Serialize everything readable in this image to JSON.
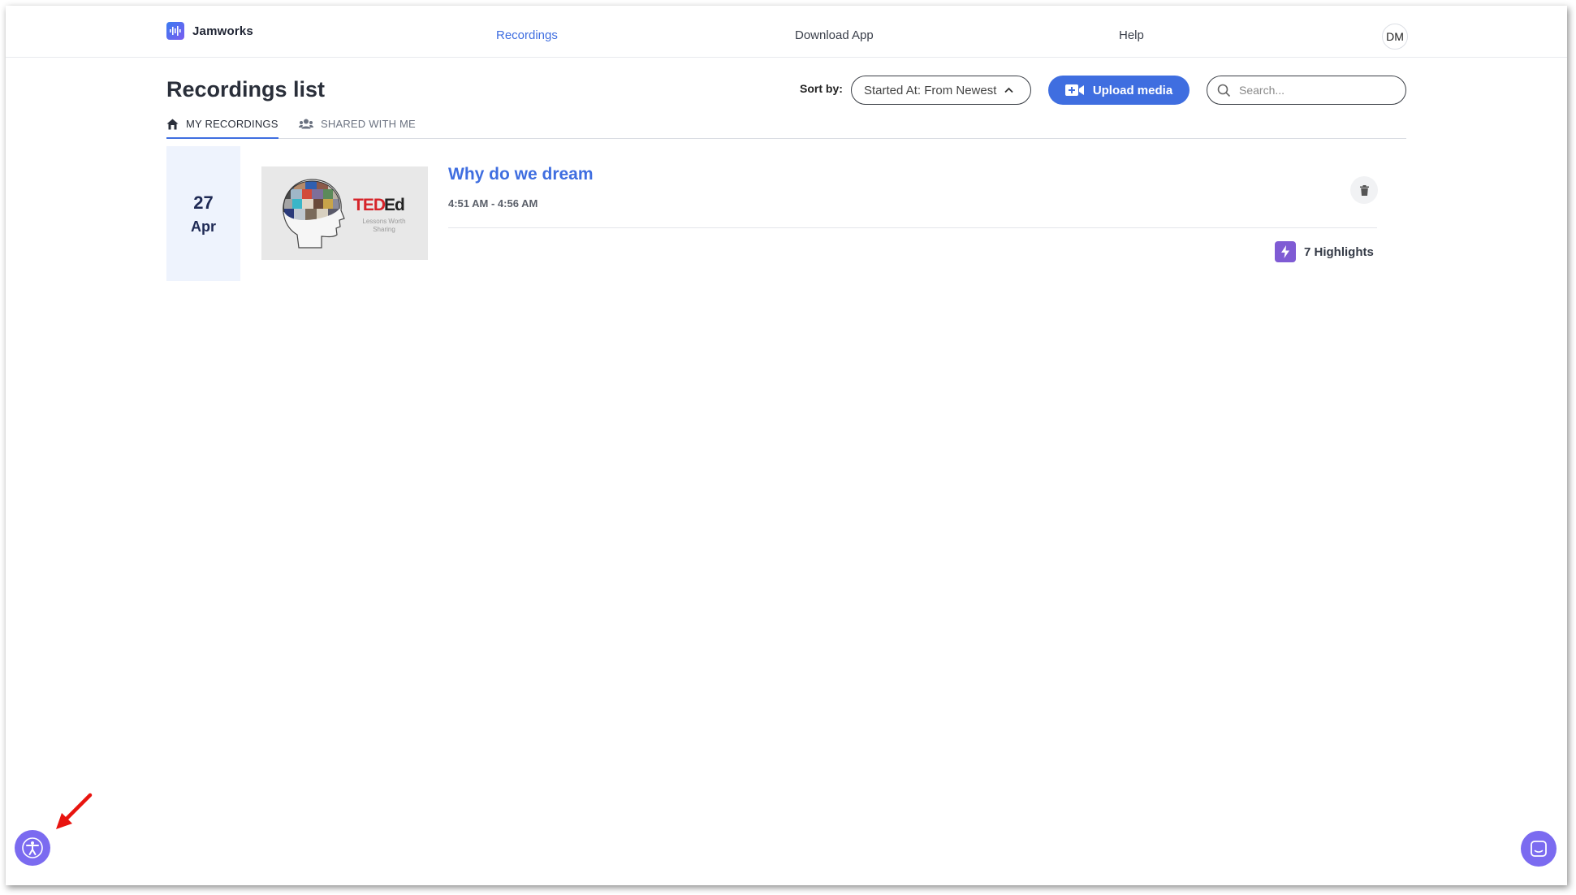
{
  "app": {
    "name": "Jamworks"
  },
  "nav": {
    "links": [
      "Recordings",
      "Download App",
      "Help"
    ],
    "active": "Recordings",
    "avatar_initials": "DM"
  },
  "header": {
    "title": "Recordings list",
    "sort_label": "Sort by:",
    "sort_value": "Started At: From Newest",
    "upload_label": "Upload media",
    "search_placeholder": "Search..."
  },
  "tabs": [
    {
      "label": "MY RECORDINGS",
      "icon": "home-icon",
      "active": true
    },
    {
      "label": "SHARED WITH ME",
      "icon": "users-icon",
      "active": false
    }
  ],
  "recordings": [
    {
      "day": "27",
      "month": "Apr",
      "title": "Why do we dream",
      "time": "4:51 AM - 4:56 AM",
      "highlights": "7 Highlights",
      "thumbnail": {
        "brand": "TEDEd",
        "brand_ted": "TED",
        "brand_ed": "Ed",
        "tagline_1": "Lessons Worth",
        "tagline_2": "Sharing"
      }
    }
  ],
  "colors": {
    "accent": "#3f6ee0",
    "highlight_purple": "#7f5bd4",
    "widget_purple": "#7b6bf0",
    "date_bg": "#eef3fd",
    "annotation_red": "#e8140f"
  },
  "icons": {
    "accessibility": "accessibility-icon",
    "chat": "chat-icon",
    "delete": "trash-icon",
    "highlight": "lightning-icon"
  }
}
